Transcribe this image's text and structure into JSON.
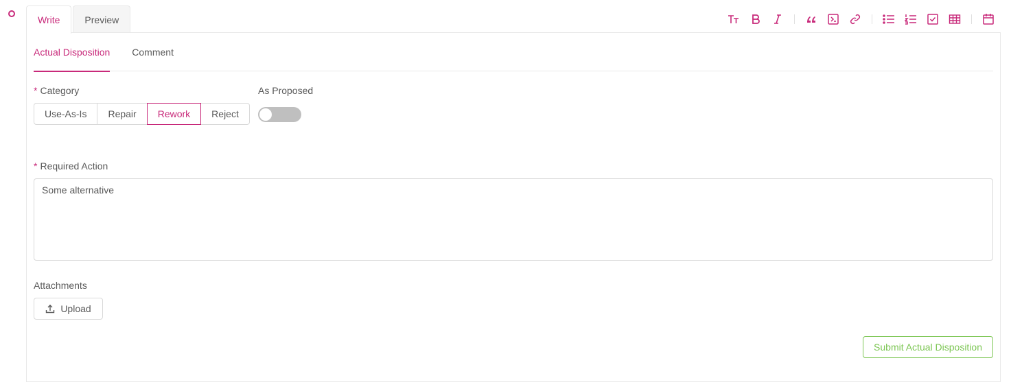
{
  "editor": {
    "tabs": [
      {
        "label": "Write",
        "active": true
      },
      {
        "label": "Preview",
        "active": false
      }
    ],
    "toolbar_icons": [
      "text-size-icon",
      "bold-icon",
      "italic-icon",
      "quote-icon",
      "code-icon",
      "link-icon",
      "bullet-list-icon",
      "numbered-list-icon",
      "task-list-icon",
      "table-icon",
      "calendar-icon"
    ]
  },
  "form": {
    "sub_tabs": [
      {
        "label": "Actual Disposition",
        "active": true
      },
      {
        "label": "Comment",
        "active": false
      }
    ],
    "category": {
      "required_mark": "*",
      "label": "Category",
      "options": [
        "Use-As-Is",
        "Repair",
        "Rework",
        "Reject"
      ],
      "selected": "Rework"
    },
    "as_proposed": {
      "label": "As Proposed",
      "enabled": false
    },
    "required_action": {
      "required_mark": "*",
      "label": "Required Action",
      "value": "Some alternative"
    },
    "attachments": {
      "label": "Attachments",
      "upload_label": "Upload"
    },
    "submit_label": "Submit Actual Disposition"
  },
  "colors": {
    "accent": "#c8297a",
    "success": "#7cc653",
    "border": "#d9d9d9",
    "text": "#595959"
  }
}
